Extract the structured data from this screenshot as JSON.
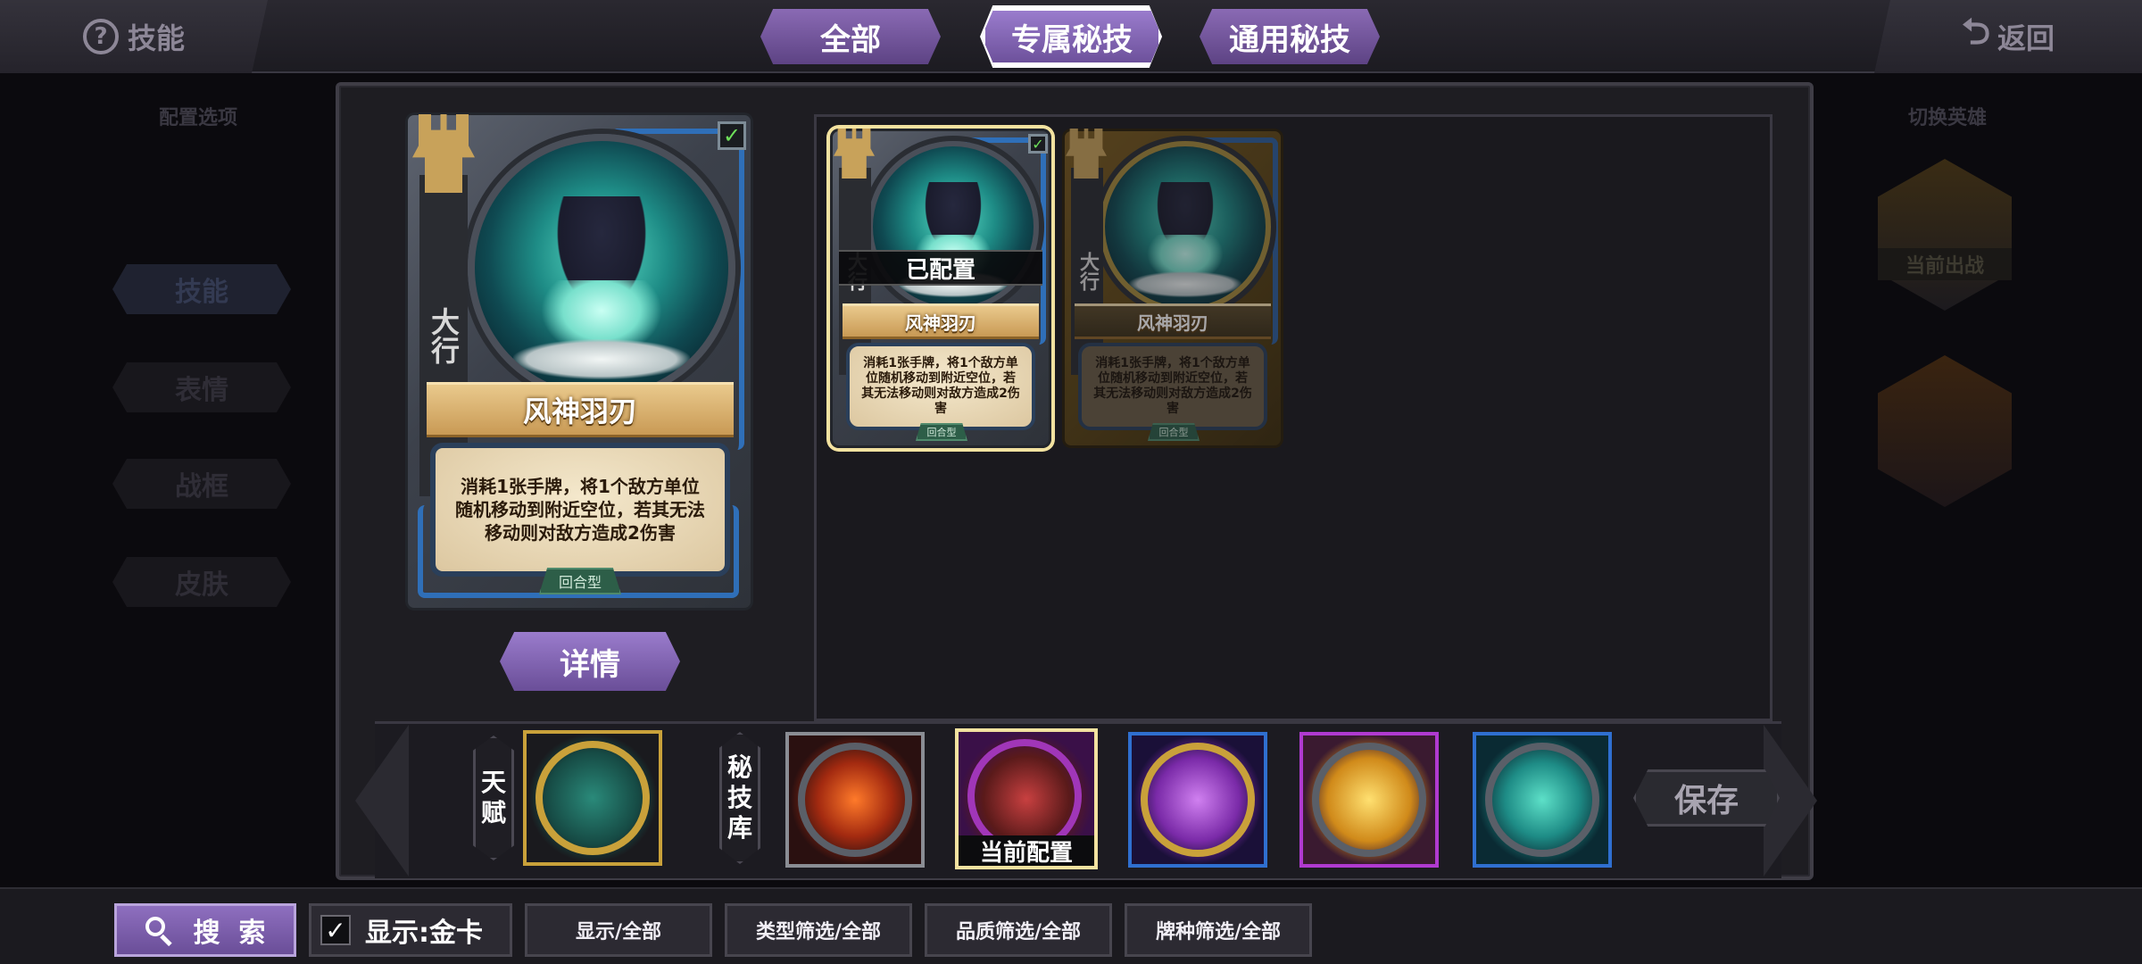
{
  "header": {
    "skill_label": "技能",
    "back_label": "返回",
    "tabs": [
      {
        "label": "全部",
        "active": false
      },
      {
        "label": "专属秘技",
        "active": true
      },
      {
        "label": "通用秘技",
        "active": false
      }
    ]
  },
  "left_menu": {
    "title": "配置选项",
    "items": [
      "技能",
      "表情",
      "战框",
      "皮肤"
    ],
    "selected": "技能"
  },
  "right_menu": {
    "title": "切换英雄",
    "current_tag": "当前出战"
  },
  "preview_card": {
    "rank": "大行",
    "name": "风神羽刃",
    "description": "消耗1张手牌，将1个敌方单位随机移动到附近空位，若其无法移动则对敌方造成2伤害",
    "type": "回合型",
    "checked": true
  },
  "detail_button": "详情",
  "grid_cards": [
    {
      "rank": "大行",
      "name": "风神羽刃",
      "description": "消耗1张手牌，将1个敌方单位随机移动到附近空位，若其无法移动则对敌方造成2伤害",
      "type": "回合型",
      "configured_label": "已配置",
      "checked": true,
      "frame": "silver"
    },
    {
      "rank": "大行",
      "name": "风神羽刃",
      "description": "消耗1张手牌，将1个敌方单位随机移动到附近空位，若其无法移动则对敌方造成2伤害",
      "type": "回合型",
      "frame": "gold"
    }
  ],
  "strip": {
    "talent_label": [
      "天",
      "赋"
    ],
    "library_label": [
      "秘",
      "技",
      "库"
    ],
    "current_config_label": "当前配置",
    "slots": [
      {
        "name": "talent",
        "frame_color": "#c9a13a"
      },
      {
        "name": "fire-fist",
        "frame_color": "#8a8d94"
      },
      {
        "name": "dark-blade",
        "frame_color": "#a036b8",
        "current": true
      },
      {
        "name": "purple-beast",
        "frame_color": "#2f6fd0"
      },
      {
        "name": "fire-horn",
        "frame_color": "#b03ad0"
      },
      {
        "name": "wind-feather",
        "frame_color": "#2f6fd0"
      }
    ],
    "save_label": "保存"
  },
  "footer": {
    "search_label": "搜  索",
    "gold_filter_label": "显示:金卡",
    "gold_filter_checked": "✓",
    "filters": [
      "显示/全部",
      "类型筛选/全部",
      "品质筛选/全部",
      "牌种筛选/全部"
    ]
  },
  "colors": {
    "accent_purple": "#7b5cab",
    "gold": "#c9a13a",
    "background": "#0b0a0e"
  }
}
